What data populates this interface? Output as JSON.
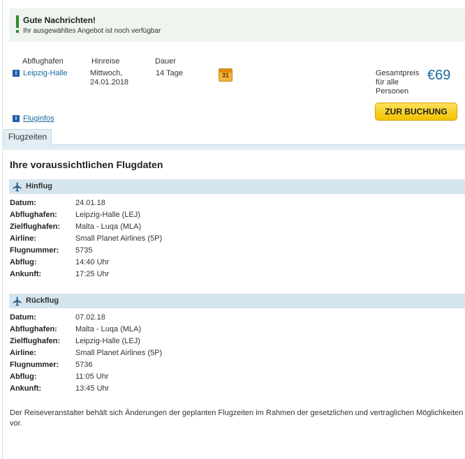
{
  "notice": {
    "title": "Gute Nachrichten!",
    "text": "Ihr ausgewähltes Angebot ist noch verfügbar"
  },
  "offer": {
    "headers": {
      "departure_airport": "Abflughafen",
      "outbound": "Hinreise",
      "duration": "Dauer"
    },
    "departure_airport": "Leipzig-Halle",
    "date_line1": "Mittwoch,",
    "date_line2": "24.01.2018",
    "duration": "14 Tage",
    "calendar_icon_text": "31",
    "total_label_line1": "Gesamtpreis",
    "total_label_line2": "für alle",
    "total_label_line3": "Personen",
    "price": "€69",
    "book_label": "ZUR BUCHUNG",
    "flightinfo_label": "Fluginfos"
  },
  "tabs": [
    {
      "label": "Flugzeiten",
      "active": true
    }
  ],
  "section_title": "Ihre voraussichtlichen Flugdaten",
  "outbound": {
    "label": "Hinflug",
    "rows": [
      {
        "key": "Datum:",
        "value": "24.01.18"
      },
      {
        "key": "Abflughafen:",
        "value": "Leipzig-Halle (LEJ)"
      },
      {
        "key": "Zielflughafen:",
        "value": "Malta - Luqa (MLA)"
      },
      {
        "key": "Airline:",
        "value": "Small Planet Airlines (5P)"
      },
      {
        "key": "Flugnummer:",
        "value": "5735"
      },
      {
        "key": "Abflug:",
        "value": "14:40 Uhr"
      },
      {
        "key": "Ankunft:",
        "value": "17:25 Uhr"
      }
    ]
  },
  "return": {
    "label": "Rückflug",
    "rows": [
      {
        "key": "Datum:",
        "value": "07.02.18"
      },
      {
        "key": "Abflughafen:",
        "value": "Malta - Luqa (MLA)"
      },
      {
        "key": "Zielflughafen:",
        "value": "Leipzig-Halle (LEJ)"
      },
      {
        "key": "Airline:",
        "value": "Small Planet Airlines (5P)"
      },
      {
        "key": "Flugnummer:",
        "value": "5736"
      },
      {
        "key": "Abflug:",
        "value": "11:05 Uhr"
      },
      {
        "key": "Ankunft:",
        "value": "13:45 Uhr"
      }
    ]
  },
  "disclaimer": "Der Reiseveranstalter behält sich Änderungen der geplanten Flugzeiten im Rahmen der gesetzlichen und vertraglichen Möglichkeiten vor.",
  "icons": {
    "notice": "exclamation-icon",
    "info": "info-icon",
    "calendar": "calendar-icon",
    "plane": "airplane-icon"
  },
  "colors": {
    "accent": "#1a6a9f",
    "success": "#2e8b2e",
    "button": "#f2c200",
    "band": "#d5e5ee"
  }
}
